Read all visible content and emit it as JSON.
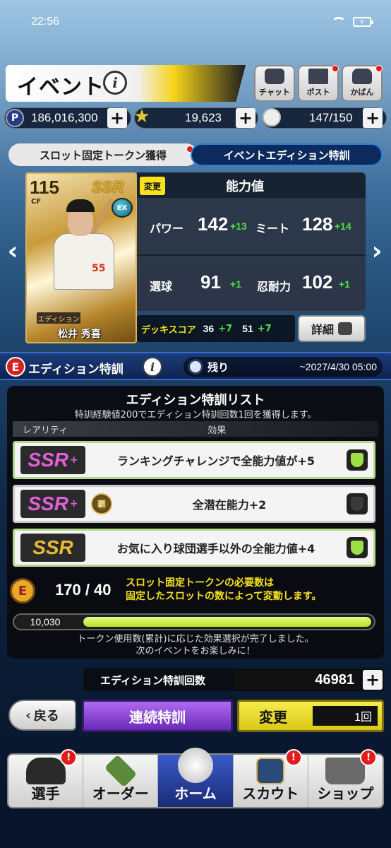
{
  "status_bar": {
    "time": "22:56"
  },
  "header": {
    "title": "イベント",
    "buttons": [
      {
        "label": "チャット",
        "icon": "chat-icon"
      },
      {
        "label": "ポスト",
        "icon": "mail-icon"
      },
      {
        "label": "かばん",
        "icon": "bag-icon"
      }
    ]
  },
  "currencies": {
    "p_points": {
      "icon_label": "P",
      "value": "186,016,300"
    },
    "stars": {
      "value": "19,623"
    },
    "balls": {
      "value": "147/150"
    }
  },
  "tabs": [
    {
      "label": "スロット固定トークン獲得"
    },
    {
      "label": "イベントエディション特訓"
    }
  ],
  "card": {
    "rating": "115",
    "position": "CF",
    "rarity": "SSR",
    "edition_label": "エディション",
    "name": "松井 秀喜",
    "badge": "EX"
  },
  "stats": {
    "change_label": "変更",
    "title": "能力値",
    "rows": [
      {
        "label": "パワー",
        "value": "142",
        "plus": "+13"
      },
      {
        "label": "ミート",
        "value": "128",
        "plus": "+14"
      },
      {
        "label": "選球",
        "value": "91",
        "plus": "+1"
      },
      {
        "label": "忍耐力",
        "value": "102",
        "plus": "+1"
      }
    ]
  },
  "deck_score": {
    "label": "デッキスコア",
    "v1": "36",
    "p1": "+7",
    "v2": "51",
    "p2": "+7"
  },
  "detail_button": "詳細",
  "edition": {
    "icon": "E",
    "title": "エディション特訓",
    "remain_label": "残り",
    "remain_date": "~2027/4/30 05:00"
  },
  "list": {
    "title": "エディション特訓リスト",
    "subtitle": "特訓経験値200でエディション特訓回数1回を獲得します。",
    "col_rarity": "レアリティ",
    "col_effect": "効果",
    "rows": [
      {
        "rarity": "SSR",
        "plus": "+",
        "effect": "ランキングチャレンジで全能力値が+5",
        "active": true
      },
      {
        "rarity": "SSR",
        "plus": "+",
        "medal": "覇",
        "effect": "全潜在能力+2",
        "active": false
      },
      {
        "rarity": "SSR",
        "plus": "",
        "effect": "お気に入り球団選手以外の全能力値+4",
        "active": true
      }
    ]
  },
  "token": {
    "icon": "E",
    "count": "170 / 40",
    "note_line1": "スロット固定トークンの必要数は",
    "note_line2": "固定したスロットの数によって変動します。"
  },
  "progress": {
    "label": "10,030",
    "fraction": 1.0
  },
  "done_message": {
    "line1": "トークン使用数(累計)に応じた効果選択が完了しました。",
    "line2": "次のイベントをお楽しみに！"
  },
  "training_count": {
    "label": "エディション特訓回数",
    "value": "46981"
  },
  "actions": {
    "back": "戻る",
    "continuous": "連続特訓",
    "change": "変更",
    "change_count": "1回"
  },
  "nav": [
    {
      "label": "選手",
      "icon": "cap-icon",
      "badge": "!"
    },
    {
      "label": "オーダー",
      "icon": "field-icon"
    },
    {
      "label": "ホーム",
      "icon": "baseball-icon",
      "active": true
    },
    {
      "label": "スカウト",
      "icon": "cards-icon",
      "badge": "!"
    },
    {
      "label": "ショップ",
      "icon": "cart-icon",
      "badge": "!"
    }
  ]
}
